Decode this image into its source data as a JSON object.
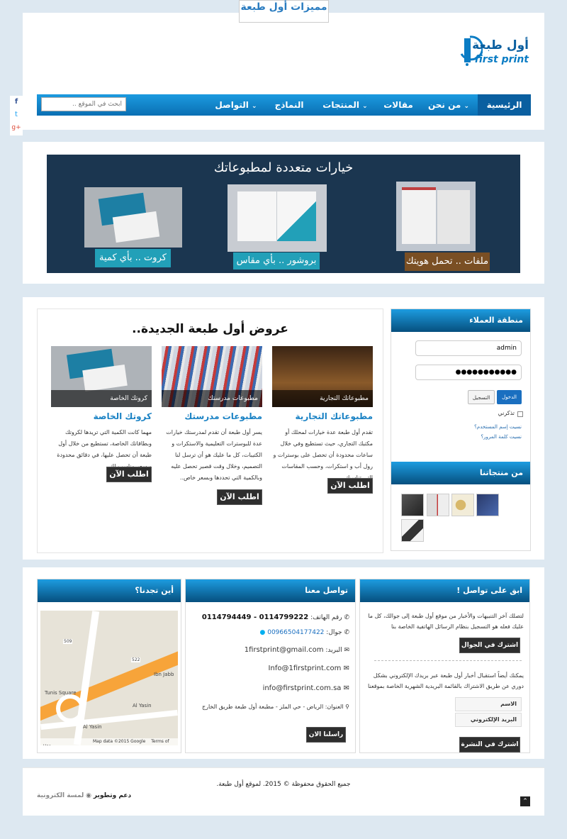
{
  "top_tab": "مميزات أول طبعة",
  "logo": {
    "ar": "أول طبعة",
    "en": "first print"
  },
  "nav": {
    "items": [
      "الرئيسية",
      "من نحن",
      "مقالات",
      "المنتجات",
      "النماذج",
      "التواصل"
    ],
    "search_placeholder": "ابحث في الموقع .."
  },
  "social": [
    "f",
    "t",
    "g+"
  ],
  "banner": {
    "title": "خيارات متعددة لمطبوعاتك",
    "captions": [
      "ملفات .. تحمل هويتك",
      "بروشور .. بأي مقاس",
      "كروت .. بأي كمية"
    ]
  },
  "offers": {
    "title": "عروض أول طبعة الجديدة..",
    "items": [
      {
        "img_label": "مطبوعاتك التجارية",
        "title": "مطبوعاتك التجارية",
        "text": "تقدم أول طبعة عدة خيارات لمحلك أو مكتبك التجاري، حيث تستطيع وفي خلال ساعات محدودة أن تحصل على بوسترات و رول أب و استكرات، وحسب المقاسات التي تناسبك ..",
        "btn": "اطلب الآن"
      },
      {
        "img_label": "مطبوعات مدرستك",
        "title": "مطبوعات مدرستك",
        "text": "يسر أول طبعة أن تقدم لمدرستك خيارات عدة للبوسترات التعليمية والاستكرات و الكتيبات، كل ما عليك هو أن ترسل لنا التصميم، وخلال وقت قصير تحصل عليه وبالكمية التي تحددها وبسعر خاص..",
        "btn": "اطلب الآن"
      },
      {
        "img_label": "كروتك الخاصة",
        "title": "كروتك الخاصة",
        "text": "مهما كانت الكمية التي تريدها لكروتك وبطاقاتك الخاصة، تستطيع من خلال أول طبعة أن تحصل عليها، في دقائق محدودة وبسعر مناسب لك..",
        "btn": "اطلب الآن"
      }
    ]
  },
  "login": {
    "title": "منطقة العملاء",
    "username": "admin",
    "password": "●●●●●●●●●●●",
    "login_btn": "الدخول",
    "register_btn": "التسجيل",
    "remember": "تذكرني",
    "forgot_user": "نسيت إسم المستخدم؟",
    "forgot_pass": "نسيت كلمة المرور؟"
  },
  "products": {
    "title": "من منتجاتنا"
  },
  "contact_subscribe": {
    "title": "ابق على تواصل !",
    "text1": "لتصلك آخر التنبيهات والأخبار من موقع أول طبعة إلى جوالك، كل ما عليك فعله هو التسجيل بنظام الرسائل الهاتفية الخاصة بنا",
    "mobile_btn": "اشترك في الجوال",
    "text2": "يمكنك أيضاً استقبال أخبار أول طبعة عبر بريدك الإلكتروني بشكل دوري عن طريق الاشتراك بالقائمة البريدية الشهرية الخاصة بموقعنا",
    "name_label": "الاسم",
    "email_label": "البريد الإلكتروني",
    "newsletter_btn": "اشترك في النشرة"
  },
  "contact_info": {
    "title": "تواصل معنا",
    "phone_label": "رقم الهاتف:",
    "phone": "0114799222 - 0114794449",
    "mobile_label": "جوال:",
    "mobile": "00966504177422",
    "email_label": "البريد:",
    "email1": "1firstprint@gmail.com",
    "email2": "Info@1firstprint.com",
    "email3": "info@firstprint.com.sa",
    "address_label": "العنوان:",
    "address": "الرياض - حي الملز - مطبعة أول طبعة طريق الخارج",
    "send_btn": "راسلنا الان"
  },
  "location": {
    "title": "أين تجدنا؟",
    "map_labels": [
      "Tunis Square",
      "Ibn Jabb",
      "Al Yasin",
      "Al Yasin",
      "522",
      "509"
    ],
    "map_footer": "Map data ©2015 Google",
    "map_terms": "Terms of Use"
  },
  "footer": {
    "copyright": "جميع الحقوق محفوظة © 2015. لموقع أول طبعة.",
    "support": "دعم وتطوير",
    "support_brand": "لمسة الكترونية"
  },
  "colors": {
    "accent": "#0a7cc4",
    "dark_banner": "#1b3650",
    "teal": "#22a0b8",
    "brown": "#7a4f24"
  }
}
